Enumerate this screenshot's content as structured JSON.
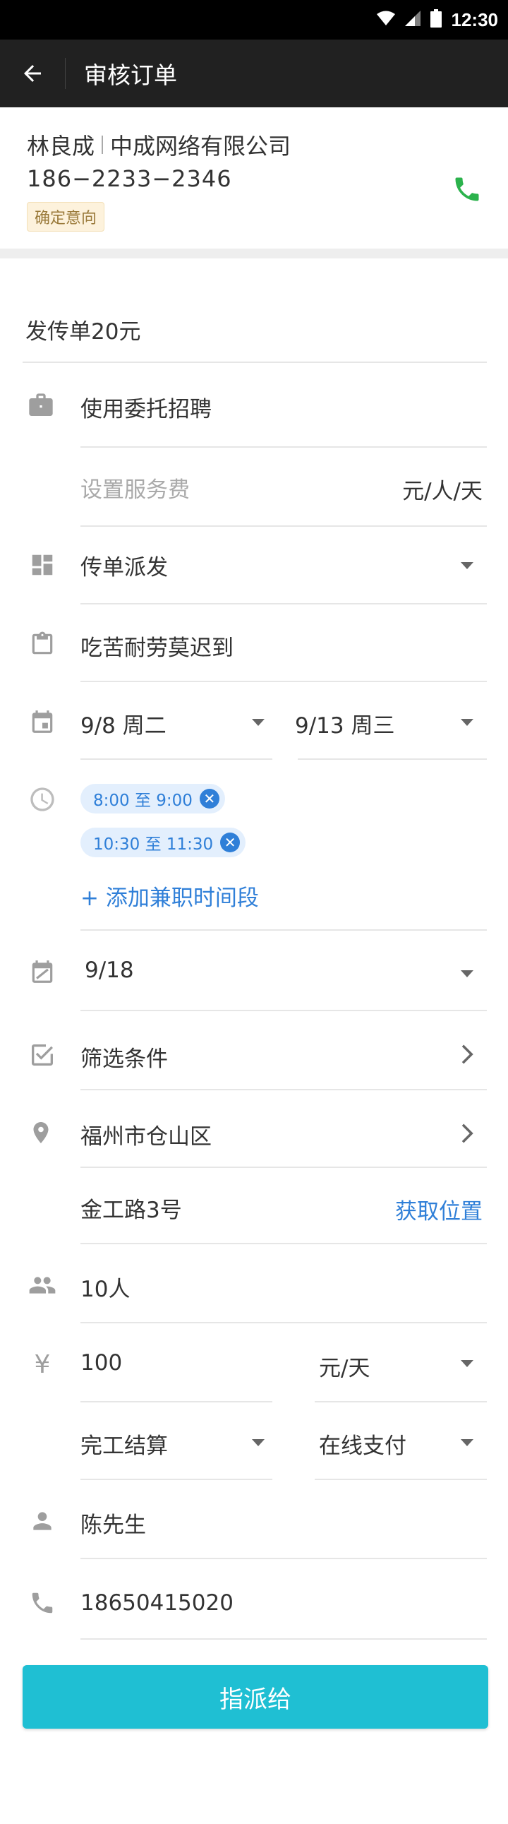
{
  "status_bar": {
    "time": "12:30"
  },
  "app_bar": {
    "title": "审核订单"
  },
  "customer": {
    "name": "林良成",
    "company": "中成网络有限公司",
    "phone": "186−2233−2346",
    "status_badge": "确定意向"
  },
  "form": {
    "job_title": "发传单20元",
    "entrust": "使用委托招聘",
    "service_fee_placeholder": "设置服务费",
    "service_fee_unit": "元/人/天",
    "category": "传单派发",
    "requirement": "吃苦耐劳莫迟到",
    "start_date": "9/8  周二",
    "end_date": "9/13  周三",
    "time_slots": [
      "8:00 至 9:00",
      "10:30 至 11:30"
    ],
    "add_time_slot": "+ 添加兼职时间段",
    "deadline_date": "9/18",
    "filter": "筛选条件",
    "city_district": "福州市仓山区",
    "address": "金工路3号",
    "get_location": "获取位置",
    "headcount": "10人",
    "currency_symbol": "¥",
    "salary": "100",
    "salary_unit": "元/天",
    "settlement": "完工结算",
    "payment": "在线支付",
    "contact_name": "陈先生",
    "contact_phone": "18650415020",
    "submit_label": "指派给"
  },
  "colors": {
    "accent": "#1fbfd3",
    "link": "#2f7fd8",
    "call_green": "#2bb24c",
    "app_bar": "#212121"
  }
}
